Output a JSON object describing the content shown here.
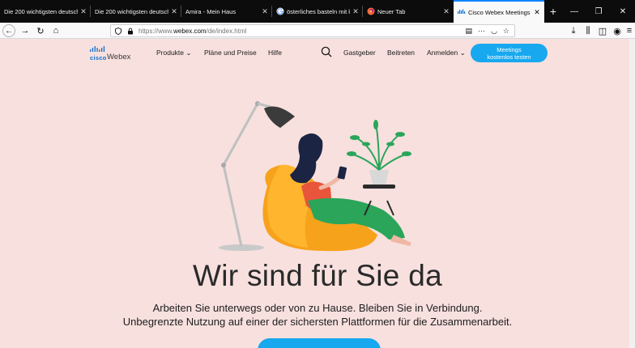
{
  "browser": {
    "tabs": [
      {
        "title": "Die 200 wichtigsten deutsche",
        "icon": "page-icon",
        "active": false
      },
      {
        "title": "Die 200 wichtigsten deutsche",
        "icon": "page-icon",
        "active": false
      },
      {
        "title": "Amira - Mein Haus",
        "icon": "page-icon",
        "active": false
      },
      {
        "title": "österliches basteln mit kin",
        "icon": "google-icon",
        "active": false
      },
      {
        "title": "Neuer Tab",
        "icon": "firefox-icon",
        "active": false
      },
      {
        "title": "Cisco Webex Meetings |",
        "icon": "webex-icon",
        "active": true
      }
    ],
    "url_scheme": "https://www.",
    "url_host": "webex.com",
    "url_path": "/de/index.html",
    "accent": "#0a84ff"
  },
  "site": {
    "logo_cisco": "cisco",
    "logo_webex": "Webex",
    "nav": {
      "products": "Produkte",
      "plans": "Pläne und Preise",
      "help": "Hilfe",
      "guest": "Gastgeber",
      "join": "Beitreten",
      "signin": "Anmelden"
    },
    "cta_line1": "Meetings",
    "cta_line2": "kostenlos testen",
    "brand_color": "#17a8ef"
  },
  "hero": {
    "title": "Wir sind für Sie da",
    "line1": "Arbeiten Sie unterwegs oder von zu Hause. Bleiben Sie in Verbindung.",
    "line2": "Unbegrenzte Nutzung auf einer der sichersten Plattformen für die Zusammenarbeit.",
    "background": "#f7e0de"
  }
}
